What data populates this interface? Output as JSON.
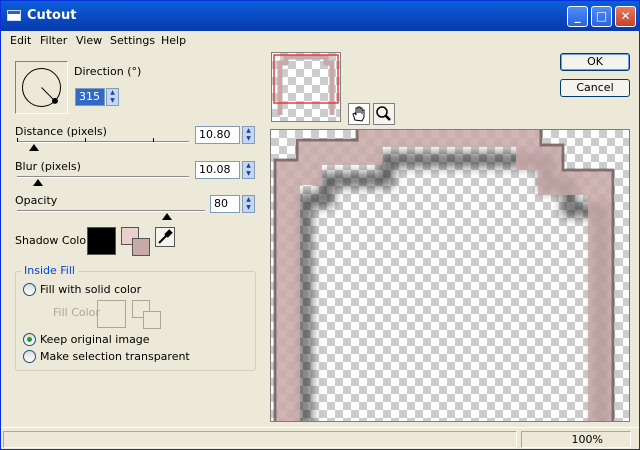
{
  "window": {
    "title": "Cutout",
    "buttons": {
      "minimize": "_",
      "maximize": "□",
      "close": "✕"
    }
  },
  "menu": {
    "items": [
      "Edit",
      "Filter",
      "View",
      "Settings",
      "Help"
    ]
  },
  "direction": {
    "label": "Direction (°)",
    "value": "315",
    "angle_degrees": 315
  },
  "distance": {
    "label": "Distance (pixels)",
    "value": "10.80",
    "slider_fraction": 0.1
  },
  "blur": {
    "label": "Blur (pixels)",
    "value": "10.08",
    "slider_fraction": 0.12
  },
  "opacity": {
    "label": "Opacity",
    "value": "80",
    "slider_fraction": 0.8
  },
  "shadow_color": {
    "label": "Shadow Color",
    "color": "#000000",
    "swatch_back": "#e8d0cc",
    "swatch_front": "#c8aaa6"
  },
  "inside_fill": {
    "title": "Inside Fill",
    "fill_solid_label": "Fill with solid color",
    "fill_color_label": "Fill Color",
    "keep_original_label": "Keep original image",
    "make_transparent_label": "Make selection transparent",
    "selected": "keep_original"
  },
  "buttons": {
    "ok": "OK",
    "cancel": "Cancel"
  },
  "tools": {
    "hand": "hand-icon",
    "zoom": "zoom-icon"
  },
  "status": {
    "zoom": "100%"
  },
  "colors": {
    "titlebar": "#0a4fc8",
    "frame": "#c8a8a8",
    "accent": "#0046d5"
  }
}
